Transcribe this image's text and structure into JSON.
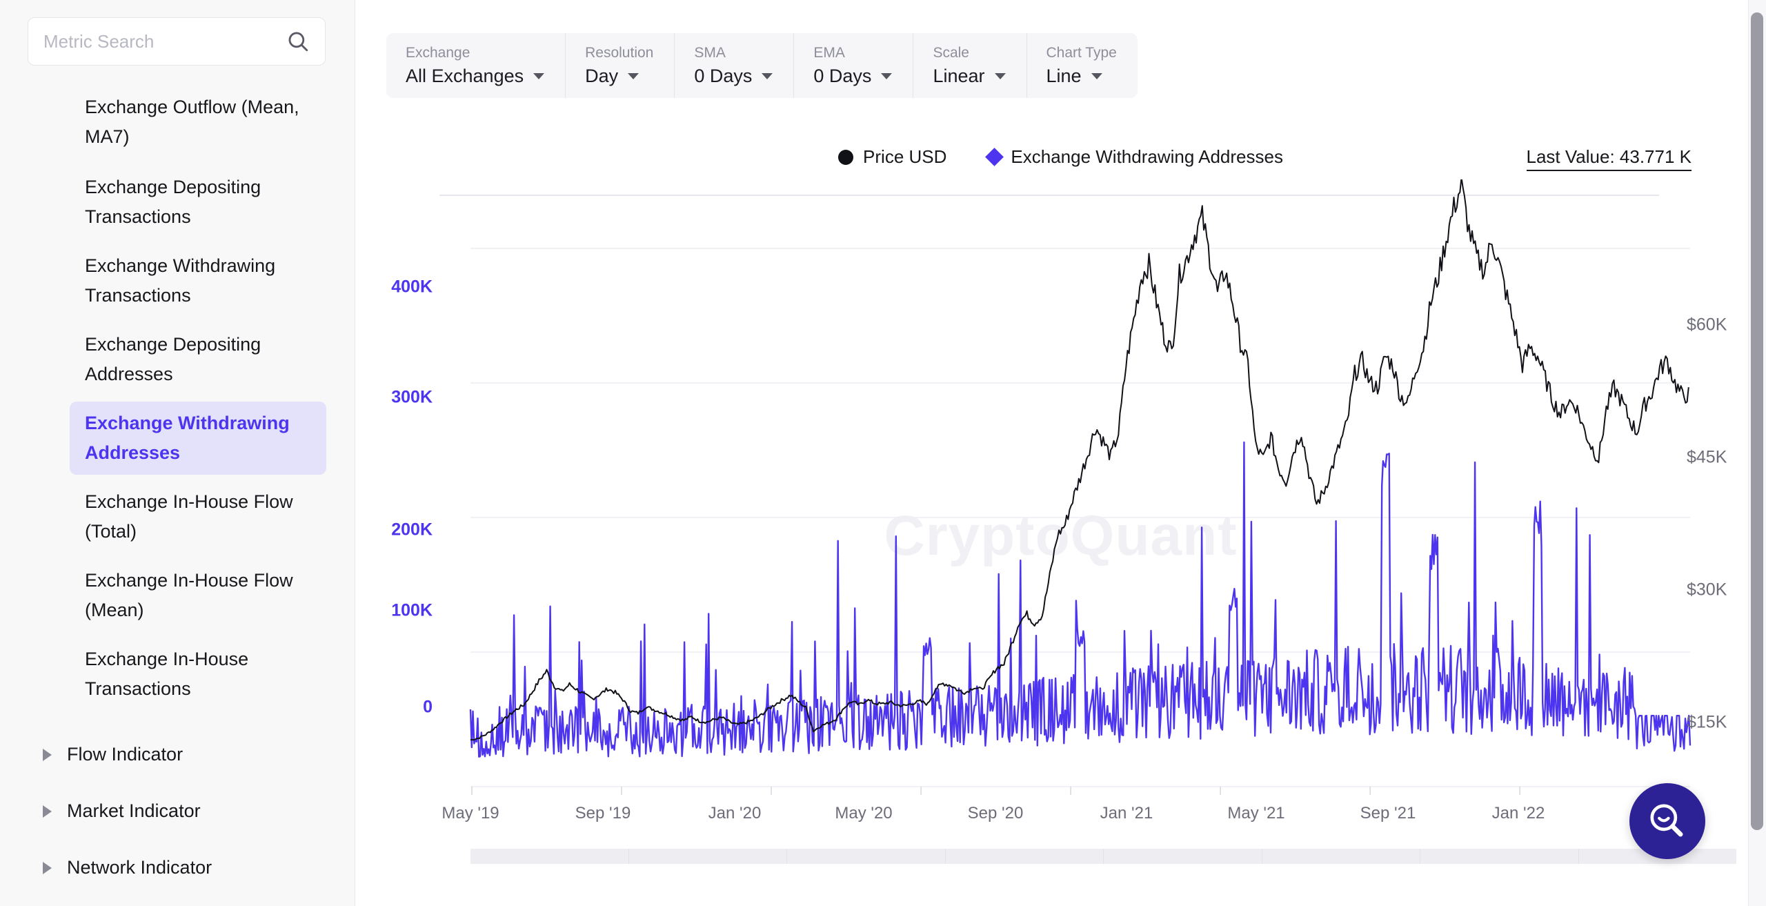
{
  "sidebar": {
    "search": {
      "placeholder": "Metric Search",
      "value": "",
      "icon": "search-icon"
    },
    "clipped_item_above": ",",
    "items": [
      {
        "label": "Exchange Outflow (Mean, MA7)",
        "active": false
      },
      {
        "label": "Exchange Depositing Transactions",
        "active": false
      },
      {
        "label": "Exchange Withdrawing Transactions",
        "active": false
      },
      {
        "label": "Exchange Depositing Addresses",
        "active": false
      },
      {
        "label": "Exchange Withdrawing Addresses",
        "active": true
      },
      {
        "label": "Exchange In-House Flow (Total)",
        "active": false
      },
      {
        "label": "Exchange In-House Flow (Mean)",
        "active": false
      },
      {
        "label": "Exchange In-House Transactions",
        "active": false
      }
    ],
    "groups": [
      {
        "label": "Flow Indicator",
        "icon": "triangle-right-icon",
        "expanded": false
      },
      {
        "label": "Market Indicator",
        "icon": "triangle-right-icon",
        "expanded": false
      },
      {
        "label": "Network Indicator",
        "icon": "triangle-right-icon",
        "expanded": false
      }
    ]
  },
  "toolbar": {
    "controls": [
      {
        "label": "Exchange",
        "value": "All Exchanges"
      },
      {
        "label": "Resolution",
        "value": "Day"
      },
      {
        "label": "SMA",
        "value": "0 Days"
      },
      {
        "label": "EMA",
        "value": "0 Days"
      },
      {
        "label": "Scale",
        "value": "Linear"
      },
      {
        "label": "Chart Type",
        "value": "Line"
      }
    ]
  },
  "chart_header": {
    "legend": [
      {
        "name": "Price USD",
        "marker": "circle",
        "color": "#111118"
      },
      {
        "name": "Exchange Withdrawing Addresses",
        "marker": "diamond",
        "color": "#4d35ef"
      }
    ],
    "last_value": "Last Value: 43.771 K"
  },
  "watermark": "CryptoQuant",
  "fab": {
    "icon": "search-smile-icon",
    "color": "#2d2196"
  },
  "colors": {
    "accent_purple": "#4d35ef",
    "price_black": "#111118",
    "highlight_bg": "#e4e2fb",
    "axis_gray": "#6d6d7a"
  },
  "chart_data": {
    "type": "line",
    "title": "",
    "xlabel": "",
    "ylabel": "Exchange Withdrawing Addresses",
    "y2label": "Price USD",
    "grid": true,
    "legend_position": "top-center",
    "x_tick_labels": [
      "May '19",
      "Sep '19",
      "Jan '20",
      "May '20",
      "Sep '20",
      "Jan '21",
      "May '21",
      "Sep '21",
      "Jan '22"
    ],
    "y_tick_labels": [
      "0",
      "100K",
      "200K",
      "300K",
      "400K"
    ],
    "y_tick_values": [
      0,
      100000,
      200000,
      300000,
      400000
    ],
    "ylim": [
      0,
      440000
    ],
    "y2_tick_labels": [
      "$15K",
      "$30K",
      "$45K",
      "$60K"
    ],
    "y2_tick_values": [
      15000,
      30000,
      45000,
      60000
    ],
    "y2lim": [
      0,
      66000
    ],
    "series": [
      {
        "name": "Price USD",
        "axis": "right",
        "color": "#111118",
        "values": [
          5200,
          5400,
          5800,
          6400,
          7200,
          7900,
          8600,
          9100,
          10400,
          11800,
          12900,
          11200,
          10600,
          11400,
          10800,
          10200,
          9800,
          10300,
          10900,
          10500,
          9700,
          8400,
          8200,
          8900,
          8600,
          8300,
          8000,
          7600,
          7400,
          7800,
          7300,
          7200,
          7500,
          7700,
          7200,
          6900,
          7100,
          7400,
          7900,
          8600,
          9200,
          9700,
          10200,
          9500,
          8800,
          6200,
          6800,
          7100,
          7600,
          8800,
          9500,
          9100,
          9700,
          9300,
          9200,
          9400,
          9100,
          9000,
          9300,
          9500,
          9200,
          10900,
          11500,
          11300,
          10700,
          10500,
          11100,
          10800,
          11900,
          13200,
          13700,
          15900,
          18400,
          19200,
          18200,
          19100,
          23500,
          28000,
          29200,
          32000,
          34500,
          37200,
          40100,
          38500,
          36800,
          39400,
          47000,
          52000,
          56800,
          58200,
          54000,
          50200,
          48500,
          57000,
          58900,
          61500,
          63500,
          59000,
          55000,
          57500,
          54000,
          49500,
          47000,
          38000,
          36500,
          39000,
          35500,
          34000,
          37500,
          39500,
          35000,
          31500,
          33000,
          35500,
          38000,
          40500,
          46000,
          47500,
          45000,
          44500,
          48000,
          47000,
          43500,
          42800,
          46500,
          49000,
          54000,
          57000,
          61000,
          64500,
          67000,
          62000,
          59000,
          57500,
          61000,
          58000,
          54500,
          51000,
          47000,
          49000,
          48000,
          45500,
          43000,
          41500,
          43000,
          42500,
          40000,
          38000,
          36500,
          42000,
          44500,
          43000,
          41000,
          39500,
          42500,
          44000,
          46500,
          47500,
          45000,
          43500,
          43771
        ],
        "last_value": 43771
      },
      {
        "name": "Exchange Withdrawing Addresses",
        "axis": "left",
        "color": "#4d35ef",
        "description": "Daily noisy spike series, baseline roughly 25K-55K with frequent spikes to 80K-120K; largest spikes around May '21 (260K), Sep '21 (210K) and Jan '21 (150K). Tapers to ~40K at the end.",
        "baseline_range": [
          22000,
          60000
        ],
        "notable_spikes": [
          {
            "x": "May '21",
            "value": 262000
          },
          {
            "x": "Sep '21",
            "value": 208000
          },
          {
            "x": "Jun '21",
            "value": 190000
          },
          {
            "x": "Jan '21",
            "value": 152000
          },
          {
            "x": "Sep '20",
            "value": 118000
          },
          {
            "x": "May '20",
            "value": 112000
          }
        ],
        "last_value": 43771
      }
    ]
  }
}
